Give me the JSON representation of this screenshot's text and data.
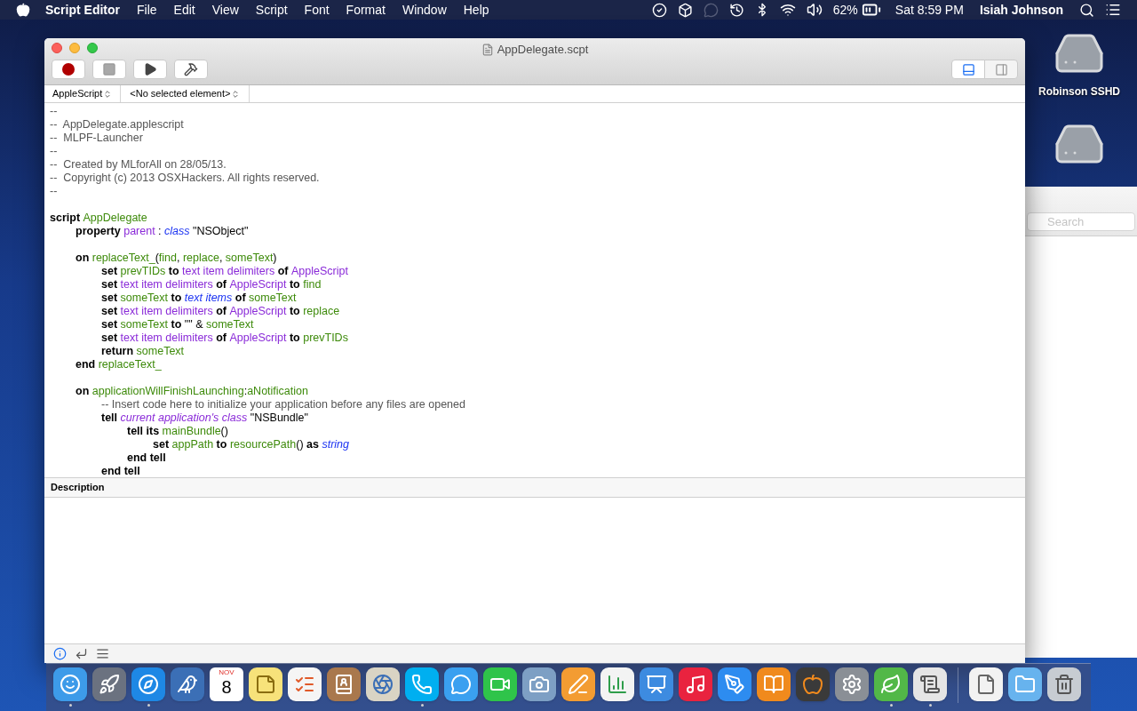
{
  "menu_bar": {
    "app_name": "Script Editor",
    "menus": [
      "File",
      "Edit",
      "View",
      "Script",
      "Font",
      "Format",
      "Window",
      "Help"
    ],
    "battery": "62%",
    "clock": "Sat 8:59 PM",
    "user": "Isiah Johnson"
  },
  "desktop_icons": [
    {
      "kind": "drive",
      "label": "Robinson SSHD"
    },
    {
      "kind": "drive"
    }
  ],
  "background_window": {
    "search": {
      "placeholder": "Search"
    }
  },
  "window": {
    "title": "AppDelegate.scpt",
    "toolbar": [
      {
        "kind": "record"
      },
      {
        "kind": "stop"
      },
      {
        "kind": "run"
      },
      {
        "kind": "compile"
      }
    ],
    "view_toggles": [
      {
        "kind": "bottom",
        "selected": true
      },
      {
        "kind": "side",
        "selected": false
      }
    ],
    "navigation": {
      "language": "AppleScript",
      "element": "<No selected element>"
    },
    "code": {
      "blocks": [
        {
          "lines": [
            {
              "tokens": [
                {
                  "kind": "comment",
                  "text": "--"
                }
              ]
            },
            {
              "tokens": [
                {
                  "kind": "comment",
                  "text": "--  AppDelegate.applescript"
                }
              ]
            },
            {
              "tokens": [
                {
                  "kind": "comment",
                  "text": "--  MLPF-Launcher"
                }
              ]
            },
            {
              "tokens": [
                {
                  "kind": "comment",
                  "text": "--"
                }
              ]
            },
            {
              "tokens": [
                {
                  "kind": "comment",
                  "text": "--  Created by MLforAll on 28/05/13."
                }
              ]
            },
            {
              "tokens": [
                {
                  "kind": "comment",
                  "text": "--  Copyright (c) 2013 OSXHackers. All rights reserved."
                }
              ]
            },
            {
              "tokens": [
                {
                  "kind": "comment",
                  "text": "--"
                }
              ]
            }
          ]
        },
        {
          "lines": [
            {
              "tokens": [
                {
                  "kind": "keyword",
                  "text": "script "
                },
                {
                  "kind": "variable",
                  "text": "AppDelegate"
                }
              ]
            },
            {
              "tokens": [
                {
                  "kind": "keyword",
                  "text": "\tproperty "
                },
                {
                  "kind": "property",
                  "text": "parent"
                },
                {
                  "kind": "plain",
                  "text": " : "
                },
                {
                  "kind": "class",
                  "text": "class"
                },
                {
                  "kind": "plain",
                  "text": " \"NSObject\""
                }
              ]
            }
          ]
        },
        {
          "lines": [
            {
              "tokens": [
                {
                  "kind": "keyword",
                  "text": "\ton "
                },
                {
                  "kind": "variable",
                  "text": "replaceText_"
                },
                {
                  "kind": "plain",
                  "text": "("
                },
                {
                  "kind": "variable",
                  "text": "find"
                },
                {
                  "kind": "plain",
                  "text": ", "
                },
                {
                  "kind": "variable",
                  "text": "replace"
                },
                {
                  "kind": "plain",
                  "text": ", "
                },
                {
                  "kind": "variable",
                  "text": "someText"
                },
                {
                  "kind": "plain",
                  "text": ")"
                }
              ]
            },
            {
              "tokens": [
                {
                  "kind": "keyword",
                  "text": "\t\tset "
                },
                {
                  "kind": "variable",
                  "text": "prevTIDs"
                },
                {
                  "kind": "keyword",
                  "text": " to "
                },
                {
                  "kind": "property",
                  "text": "text item delimiters"
                },
                {
                  "kind": "keyword",
                  "text": " of "
                },
                {
                  "kind": "property",
                  "text": "AppleScript"
                }
              ]
            },
            {
              "tokens": [
                {
                  "kind": "keyword",
                  "text": "\t\tset "
                },
                {
                  "kind": "property",
                  "text": "text item delimiters"
                },
                {
                  "kind": "keyword",
                  "text": " of "
                },
                {
                  "kind": "property",
                  "text": "AppleScript"
                },
                {
                  "kind": "keyword",
                  "text": " to "
                },
                {
                  "kind": "variable",
                  "text": "find"
                }
              ]
            },
            {
              "tokens": [
                {
                  "kind": "keyword",
                  "text": "\t\tset "
                },
                {
                  "kind": "variable",
                  "text": "someText"
                },
                {
                  "kind": "keyword",
                  "text": " to "
                },
                {
                  "kind": "class",
                  "text": "text items"
                },
                {
                  "kind": "keyword",
                  "text": " of "
                },
                {
                  "kind": "variable",
                  "text": "someText"
                }
              ]
            },
            {
              "tokens": [
                {
                  "kind": "keyword",
                  "text": "\t\tset "
                },
                {
                  "kind": "property",
                  "text": "text item delimiters"
                },
                {
                  "kind": "keyword",
                  "text": " of "
                },
                {
                  "kind": "property",
                  "text": "AppleScript"
                },
                {
                  "kind": "keyword",
                  "text": " to "
                },
                {
                  "kind": "variable",
                  "text": "replace"
                }
              ]
            },
            {
              "tokens": [
                {
                  "kind": "keyword",
                  "text": "\t\tset "
                },
                {
                  "kind": "variable",
                  "text": "someText"
                },
                {
                  "kind": "keyword",
                  "text": " to "
                },
                {
                  "kind": "plain",
                  "text": "\"\" & "
                },
                {
                  "kind": "variable",
                  "text": "someText"
                }
              ]
            },
            {
              "tokens": [
                {
                  "kind": "keyword",
                  "text": "\t\tset "
                },
                {
                  "kind": "property",
                  "text": "text item delimiters"
                },
                {
                  "kind": "keyword",
                  "text": " of "
                },
                {
                  "kind": "property",
                  "text": "AppleScript"
                },
                {
                  "kind": "keyword",
                  "text": " to "
                },
                {
                  "kind": "variable",
                  "text": "prevTIDs"
                }
              ]
            },
            {
              "tokens": [
                {
                  "kind": "keyword",
                  "text": "\t\treturn "
                },
                {
                  "kind": "variable",
                  "text": "someText"
                }
              ]
            },
            {
              "tokens": [
                {
                  "kind": "keyword",
                  "text": "\tend "
                },
                {
                  "kind": "variable",
                  "text": "replaceText_"
                }
              ]
            }
          ]
        },
        {
          "lines": [
            {
              "tokens": [
                {
                  "kind": "keyword",
                  "text": "\ton "
                },
                {
                  "kind": "variable",
                  "text": "applicationWillFinishLaunching"
                },
                {
                  "kind": "plain",
                  "text": ":"
                },
                {
                  "kind": "variable",
                  "text": "aNotification"
                }
              ]
            },
            {
              "tokens": [
                {
                  "kind": "comment",
                  "text": "\t\t-- Insert code here to initialize your application before any files are opened"
                }
              ]
            },
            {
              "tokens": [
                {
                  "kind": "keyword",
                  "text": "\t\ttell "
                },
                {
                  "kind": "app_class",
                  "text": "current application's class"
                },
                {
                  "kind": "plain",
                  "text": " \"NSBundle\""
                }
              ]
            },
            {
              "tokens": [
                {
                  "kind": "keyword",
                  "text": "\t\t\ttell its "
                },
                {
                  "kind": "variable",
                  "text": "mainBundle"
                },
                {
                  "kind": "plain",
                  "text": "()"
                }
              ]
            },
            {
              "tokens": [
                {
                  "kind": "keyword",
                  "text": "\t\t\t\tset "
                },
                {
                  "kind": "variable",
                  "text": "appPath"
                },
                {
                  "kind": "keyword",
                  "text": " to "
                },
                {
                  "kind": "variable",
                  "text": "resourcePath"
                },
                {
                  "kind": "plain",
                  "text": "()"
                },
                {
                  "kind": "keyword",
                  "text": " as "
                },
                {
                  "kind": "class",
                  "text": "string"
                }
              ]
            },
            {
              "tokens": [
                {
                  "kind": "keyword",
                  "text": "\t\t\tend tell"
                }
              ]
            },
            {
              "tokens": [
                {
                  "kind": "keyword",
                  "text": "\t\tend tell"
                }
              ]
            }
          ]
        }
      ]
    },
    "description_header": "Description",
    "bottom_tabs": [
      {
        "kind": "info",
        "selected": true
      },
      {
        "kind": "replies",
        "selected": false
      },
      {
        "kind": "log",
        "selected": false
      }
    ]
  },
  "dock": {
    "apps": [
      {
        "kind": "finder",
        "color": "#3d9be9",
        "running": true
      },
      {
        "kind": "launchpad",
        "color": "#6b7280",
        "running": false
      },
      {
        "kind": "safari",
        "color": "#1e88e5",
        "running": true
      },
      {
        "kind": "mail",
        "color": "#3b6fb6",
        "running": false
      },
      {
        "kind": "calendar",
        "color": "#ffffff",
        "running": false,
        "month": "NOV",
        "day": "8"
      },
      {
        "kind": "notes",
        "color": "#f7e27a",
        "running": false
      },
      {
        "kind": "reminders",
        "color": "#f5f5f5",
        "running": false
      },
      {
        "kind": "contacts",
        "color": "#a9784d",
        "running": false
      },
      {
        "kind": "photo_booth",
        "color": "#d9d4c4",
        "running": false
      },
      {
        "kind": "skype",
        "color": "#00aff0",
        "running": true
      },
      {
        "kind": "messages",
        "color": "#3aa0f0",
        "running": false
      },
      {
        "kind": "facetime",
        "color": "#2fc44a",
        "running": false
      },
      {
        "kind": "iphoto",
        "color": "#7d9fc4",
        "running": false
      },
      {
        "kind": "pages",
        "color": "#f39c32",
        "running": false
      },
      {
        "kind": "numbers",
        "color": "#f3f3f3",
        "running": false
      },
      {
        "kind": "keynote",
        "color": "#3d8be0",
        "running": false
      },
      {
        "kind": "itunes",
        "color": "#e9233f",
        "running": false
      },
      {
        "kind": "app_store",
        "color": "#2d8cf0",
        "running": false
      },
      {
        "kind": "ibooks",
        "color": "#f08a1d",
        "running": false
      },
      {
        "kind": "chalkboard",
        "color": "#3a3a3a",
        "running": false
      },
      {
        "kind": "preferences",
        "color": "#8a8f96",
        "running": false
      },
      {
        "kind": "leaf",
        "color": "#52b848",
        "running": true
      },
      {
        "kind": "script_editor",
        "color": "#e5e5e5",
        "running": true
      }
    ],
    "others": [
      {
        "kind": "document",
        "color": "#f2f2f2"
      },
      {
        "kind": "folder",
        "color": "#67b3ee"
      },
      {
        "kind": "trash",
        "color": "#c7ccd2"
      }
    ]
  }
}
